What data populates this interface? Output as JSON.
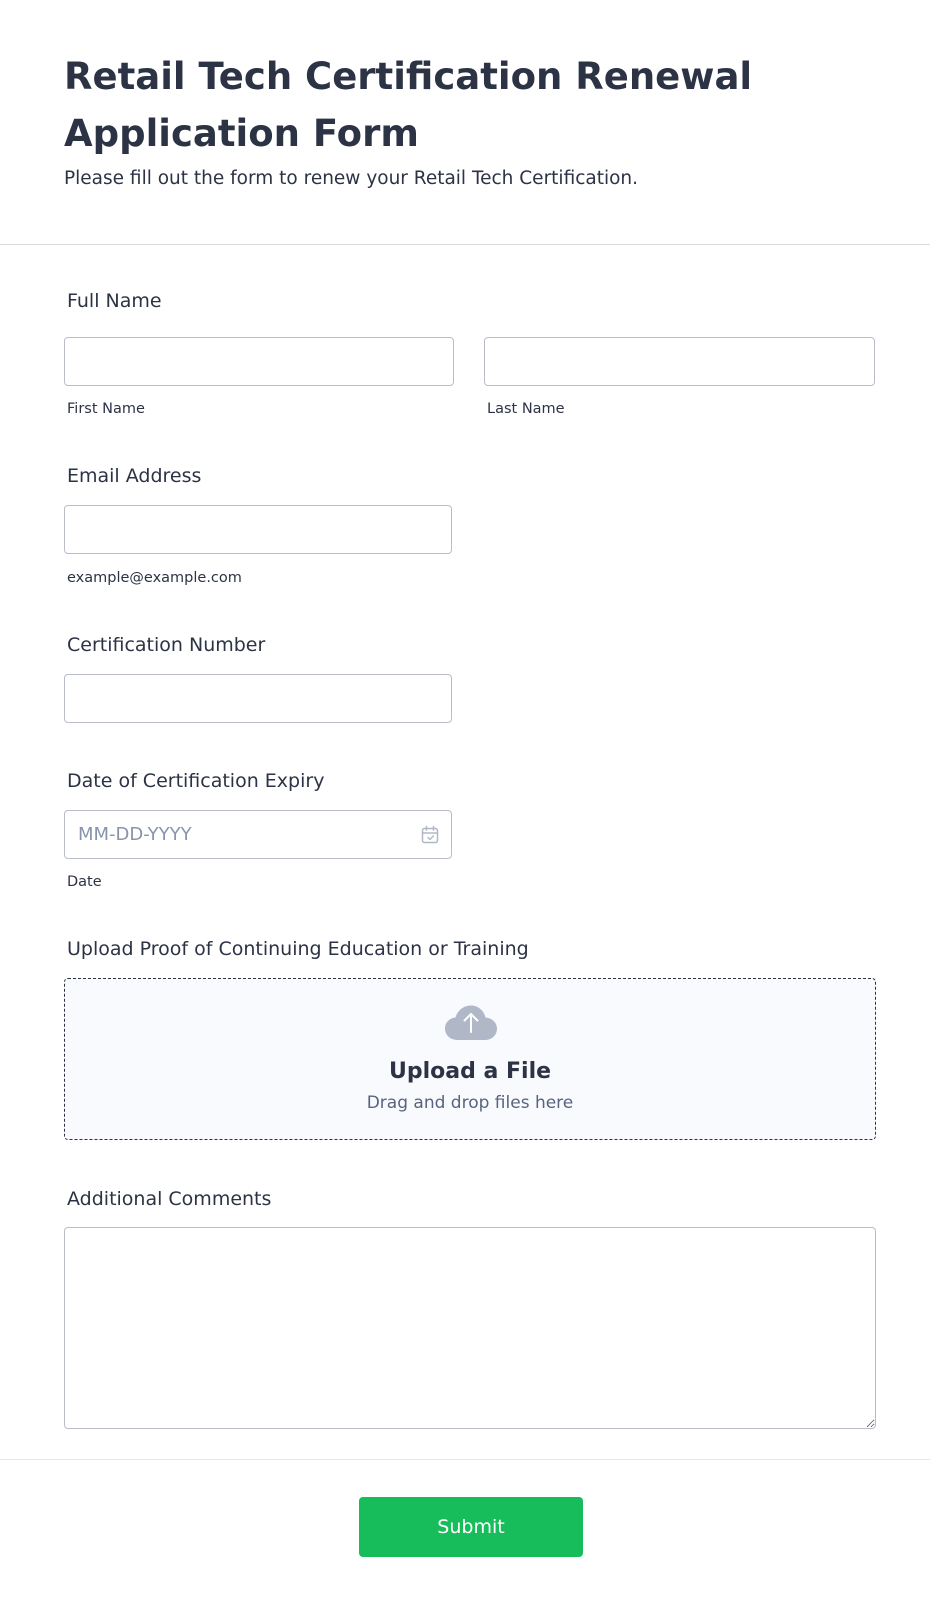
{
  "header": {
    "title": "Retail Tech Certification Renewal Application Form",
    "subtitle": "Please fill out the form to renew your Retail Tech Certification."
  },
  "full_name": {
    "label": "Full Name",
    "first_value": "",
    "first_sublabel": "First Name",
    "last_value": "",
    "last_sublabel": "Last Name"
  },
  "email": {
    "label": "Email Address",
    "value": "",
    "sublabel": "example@example.com"
  },
  "certification_number": {
    "label": "Certification Number",
    "value": ""
  },
  "expiry_date": {
    "label": "Date of Certification Expiry",
    "placeholder": "MM-DD-YYYY",
    "sublabel": "Date",
    "icon": "calendar-icon"
  },
  "upload": {
    "label": "Upload Proof of Continuing Education or Training",
    "title": "Upload a File",
    "subtitle": "Drag and drop files here",
    "icon": "cloud-upload-icon"
  },
  "comments": {
    "label": "Additional Comments",
    "value": ""
  },
  "submit": {
    "label": "Submit"
  },
  "colors": {
    "text": "#2c3345",
    "border": "#b8bdc9",
    "submit_bg": "#18bd5b",
    "upload_bg": "#f9fafd",
    "icon_gray": "#b0b8c8"
  }
}
